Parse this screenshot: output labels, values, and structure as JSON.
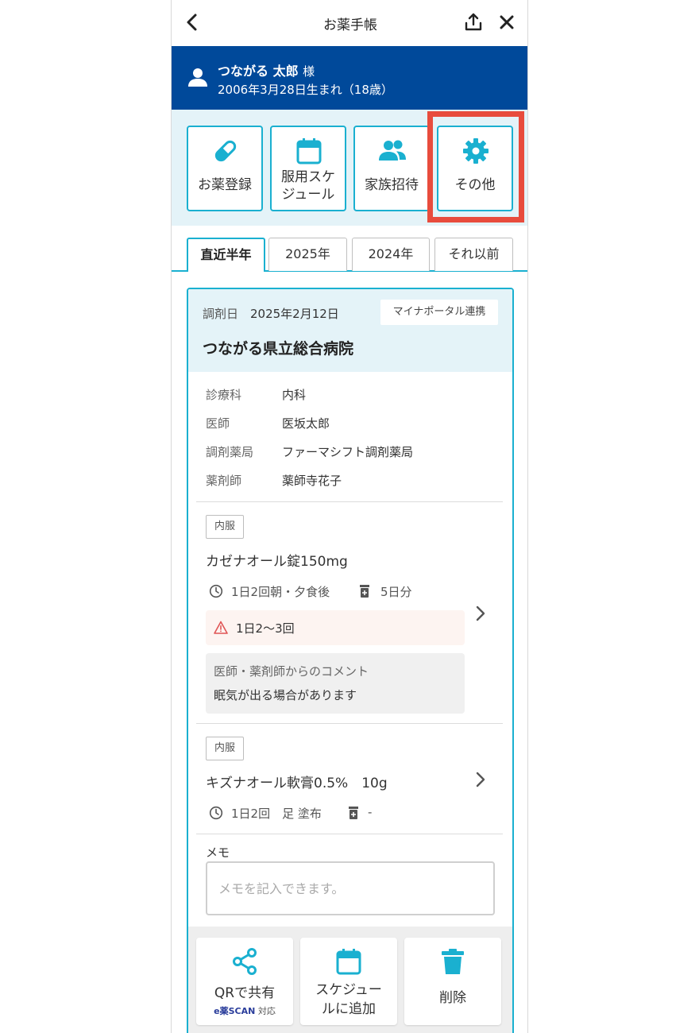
{
  "header": {
    "title": "お薬手帳"
  },
  "user": {
    "name": "つながる 太郎",
    "honorific": "様",
    "birth": "2006年3月28日生まれ（18歳）"
  },
  "menu": {
    "items": [
      {
        "label_lines": [
          "お薬登録"
        ],
        "icon": "capsule-icon"
      },
      {
        "label_lines": [
          "服用スケ",
          "ジュール"
        ],
        "icon": "calendar-icon"
      },
      {
        "label_lines": [
          "家族招待"
        ],
        "icon": "people-icon"
      },
      {
        "label_lines": [
          "その他"
        ],
        "icon": "gear-icon"
      }
    ]
  },
  "tabs": [
    {
      "label": "直近半年",
      "active": true
    },
    {
      "label": "2025年",
      "active": false
    },
    {
      "label": "2024年",
      "active": false
    },
    {
      "label": "それ以前",
      "active": false
    }
  ],
  "record": {
    "dispense_label": "調剤日",
    "dispense_date": "2025年2月12日",
    "source_badge": "マイナポータル連携",
    "hospital": "つながる県立総合病院",
    "info": [
      {
        "label": "診療科",
        "value": "内科"
      },
      {
        "label": "医師",
        "value": "医坂太郎"
      },
      {
        "label": "調剤薬局",
        "value": "ファーマシフト調剤薬局"
      },
      {
        "label": "薬剤師",
        "value": "薬師寺花子"
      }
    ],
    "drugs": [
      {
        "kind": "内服",
        "name": "カゼナオール錠150mg",
        "dosage": "1日2回朝・夕食後",
        "days": "5日分",
        "warning": "1日2〜3回",
        "comment_label": "医師・薬剤師からのコメント",
        "comment": "眠気が出る場合があります"
      },
      {
        "kind": "内服",
        "name": "キズナオール軟膏0.5%　10g",
        "dosage": "1日2回　足 塗布",
        "days": "-"
      }
    ],
    "memo": {
      "label": "メモ",
      "placeholder": "メモを記入できます。",
      "value": ""
    }
  },
  "actions": {
    "share_label": "QRで共有",
    "share_sub_brand": "e薬SCAN",
    "share_sub_suffix": "対応",
    "schedule_lines": [
      "スケジュー",
      "ルに追加"
    ],
    "delete_label": "削除"
  },
  "colors": {
    "brand_blue": "#00499a",
    "accent_cyan": "#1ab0d0",
    "highlight_red": "#e84c3d",
    "panel_bg": "#e4f3f8"
  }
}
